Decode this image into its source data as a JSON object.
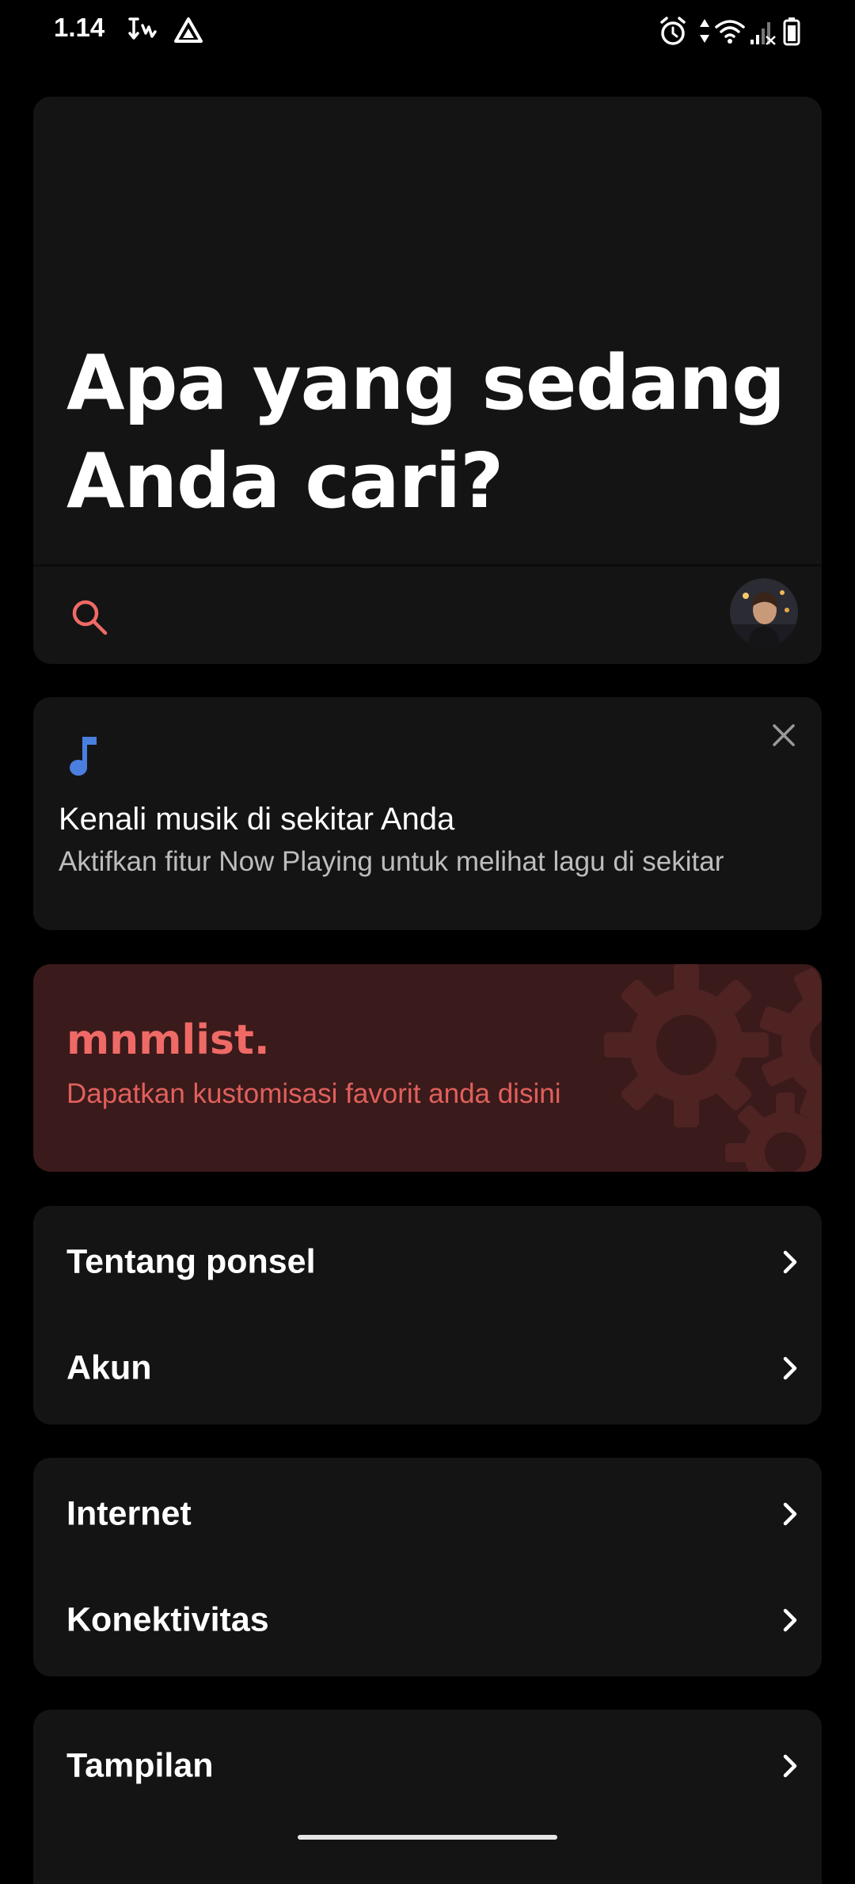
{
  "status_bar": {
    "time": "1.14",
    "left_icons": [
      "data-saver-icon",
      "drive-icon"
    ],
    "right_icons": [
      "alarm-icon",
      "data-arrows-icon",
      "wifi-icon",
      "signal-icon",
      "battery-icon"
    ]
  },
  "hero": {
    "title": "Apa yang sedang Anda cari?",
    "search_icon": "search-icon",
    "avatar": "avatar"
  },
  "now_playing": {
    "icon": "music-note-icon",
    "title": "Kenali musik di sekitar Anda",
    "subtitle": "Aktifkan fitur Now Playing untuk melihat lagu di sekitar",
    "close_icon": "close-icon"
  },
  "banner": {
    "title": "mnmlist.",
    "subtitle": "Dapatkan kustomisasi favorit anda disini",
    "decoration": "gears-icon"
  },
  "menu": {
    "group1": [
      {
        "label": "Tentang ponsel"
      },
      {
        "label": "Akun"
      }
    ],
    "group2": [
      {
        "label": "Internet"
      },
      {
        "label": "Konektivitas"
      }
    ],
    "group3": [
      {
        "label": "Tampilan"
      }
    ]
  },
  "colors": {
    "background": "#000000",
    "card": "#141414",
    "accent": "#ef6a66",
    "banner_bg": "#3a1a1a",
    "music_icon": "#4a7fe0"
  }
}
